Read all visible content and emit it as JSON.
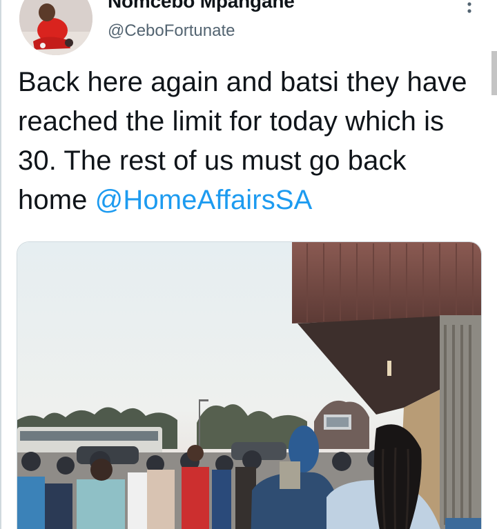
{
  "tweet": {
    "display_name": "Nomcebo Mpangane",
    "handle": "@CeboFortunate",
    "text_before_mention": "Back here again and batsi they have reached the limit for today which is 30. The rest of us must go back home ",
    "mention": "@HomeAffairsSA",
    "more_icon": "more-vertical-icon"
  },
  "colors": {
    "text": "#0f1419",
    "secondary_text": "#536471",
    "link": "#1d9bf0"
  }
}
